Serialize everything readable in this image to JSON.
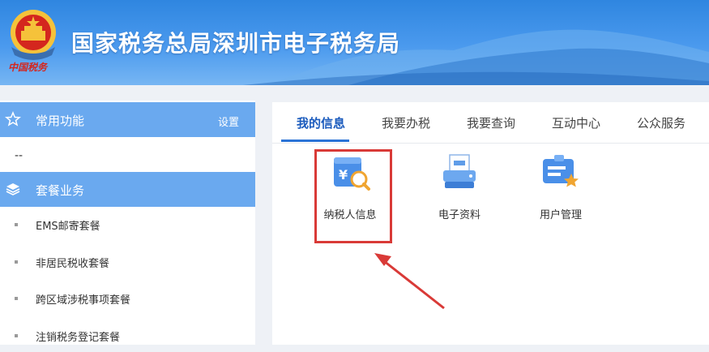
{
  "header": {
    "title": "国家税务总局深圳市电子税务局",
    "emblem_icon": "national-emblem-icon",
    "emblem_caption": "中国税务",
    "colors": {
      "banner_top": "#2f86e0",
      "banner_bottom": "#77b6f3"
    }
  },
  "sidebar": {
    "common": {
      "icon": "star-icon",
      "label": "常用功能",
      "settings_label": "设置"
    },
    "common_placeholder": "--",
    "package": {
      "icon": "layers-icon",
      "label": "套餐业务"
    },
    "items": [
      {
        "label": "EMS邮寄套餐"
      },
      {
        "label": "非居民税收套餐"
      },
      {
        "label": "跨区域涉税事项套餐"
      },
      {
        "label": "注销税务登记套餐"
      }
    ],
    "colors": {
      "section_header": "#6aa9ef"
    }
  },
  "main": {
    "tabs": [
      {
        "label": "我的信息",
        "active": true
      },
      {
        "label": "我要办税"
      },
      {
        "label": "我要查询"
      },
      {
        "label": "互动中心"
      },
      {
        "label": "公众服务"
      }
    ],
    "apps": [
      {
        "label": "纳税人信息",
        "icon": "taxpayer-info-icon",
        "highlighted": true
      },
      {
        "label": "电子资料",
        "icon": "printer-document-icon"
      },
      {
        "label": "用户管理",
        "icon": "user-management-icon"
      }
    ],
    "colors": {
      "active_tab": "#1b5bbd",
      "annotation": "#d93a37"
    }
  }
}
